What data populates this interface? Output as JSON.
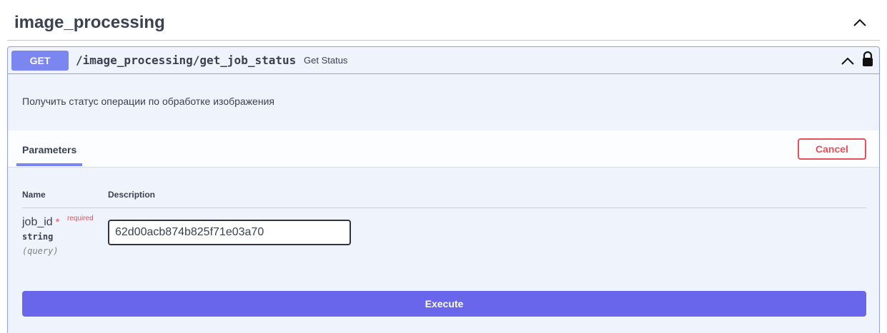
{
  "section": {
    "title": "image_processing"
  },
  "operation": {
    "method": "GET",
    "path": "/image_processing/get_job_status",
    "summary": "Get Status",
    "description": "Получить статус операции по обработке изображения"
  },
  "parameters": {
    "tab_label": "Parameters",
    "cancel_label": "Cancel",
    "columns": {
      "name": "Name",
      "description": "Description"
    },
    "items": [
      {
        "name": "job_id",
        "star": "*",
        "required_label": "required",
        "type": "string",
        "in": "(query)",
        "value": "62d00acb874b825f71e03a70"
      }
    ]
  },
  "execute_label": "Execute",
  "colors": {
    "method_get": "#7b86f1",
    "cancel": "#e6505a",
    "execute": "#6a66ec",
    "text": "#3b4151"
  }
}
